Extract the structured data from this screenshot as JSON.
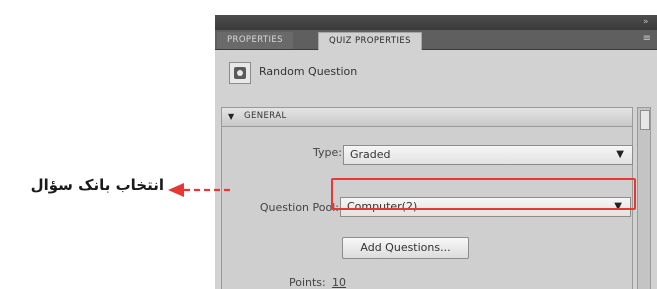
{
  "panel": {
    "tabs": [
      {
        "label": "PROPERTIES",
        "active": false
      },
      {
        "label": "QUIZ PROPERTIES",
        "active": true
      }
    ],
    "header": {
      "icon": "random-question-icon",
      "label": "Random Question"
    },
    "section": {
      "label": "GENERAL"
    },
    "fields": {
      "type": {
        "label": "Type:",
        "value": "Graded"
      },
      "pool": {
        "label": "Question Pool:",
        "value": "Computer(2)"
      },
      "add_questions_button": "Add Questions...",
      "points": {
        "label": "Points:",
        "value": "10"
      }
    }
  },
  "callout": {
    "text": "انتخاب بانک سؤال"
  },
  "colors": {
    "highlight": "#e53935",
    "panel_bg": "#d2d2d2",
    "tab_bar": "#5f5f5f"
  }
}
